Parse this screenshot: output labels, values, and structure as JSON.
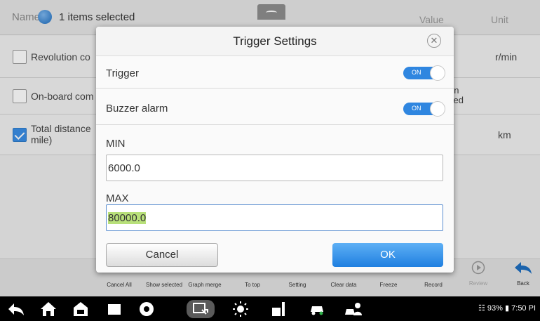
{
  "header": {
    "name_label": "Name",
    "selected_text": "1 items selected",
    "value_col": "Value",
    "unit_col": "Unit"
  },
  "rows": [
    {
      "label": "Revolution co",
      "value": "",
      "unit": "r/min",
      "checked": false
    },
    {
      "label": "On-board com",
      "value": "on\nsed",
      "unit": "",
      "checked": false
    },
    {
      "label": "Total distance\nmile)",
      "value": "",
      "unit": "km",
      "checked": true
    }
  ],
  "toolbar": [
    {
      "label": "Cancel All",
      "icon": "cancel-all-icon"
    },
    {
      "label": "Show selected",
      "icon": "show-selected-icon"
    },
    {
      "label": "Graph merge",
      "icon": "graph-merge-icon"
    },
    {
      "label": "To top",
      "icon": "to-top-icon"
    },
    {
      "label": "Setting",
      "icon": "setting-icon"
    },
    {
      "label": "Clear data",
      "icon": "clear-data-icon"
    },
    {
      "label": "Freeze",
      "icon": "freeze-icon"
    },
    {
      "label": "Record",
      "icon": "record-icon"
    },
    {
      "label": "Review",
      "icon": "review-icon"
    },
    {
      "label": "Back",
      "icon": "back-arrow-icon"
    }
  ],
  "dialog": {
    "title": "Trigger Settings",
    "trigger_label": "Trigger",
    "trigger_state": "ON",
    "buzzer_label": "Buzzer alarm",
    "buzzer_state": "ON",
    "min_label": "MIN",
    "min_value": "6000.0",
    "max_label": "MAX",
    "max_value": "80000.0",
    "cancel_label": "Cancel",
    "ok_label": "OK"
  },
  "statusbar": {
    "battery": "93%",
    "time": "7:50 PI"
  },
  "colors": {
    "accent": "#2f86e0",
    "highlight": "#b8e07a"
  }
}
